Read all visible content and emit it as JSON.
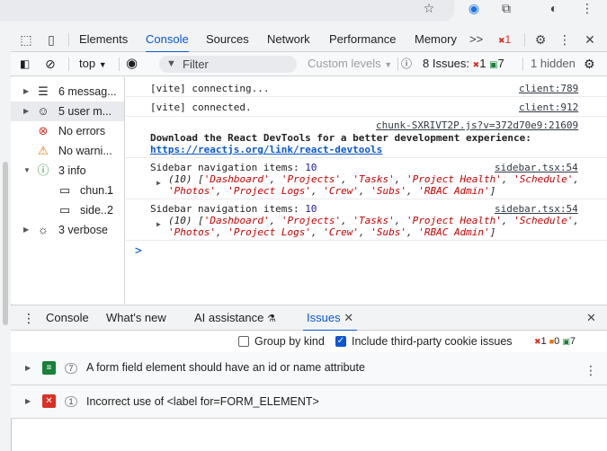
{
  "colors": {
    "accent": "#0b57d0",
    "error": "#d93025",
    "warning": "#e37400",
    "info": "#1e8e3e",
    "chat": "#188038"
  },
  "main_tabs": [
    "Elements",
    "Console",
    "Sources",
    "Network",
    "Performance",
    "Memory"
  ],
  "main_tabs_active": "Console",
  "tabbar": {
    "more": ">>",
    "error_count": "1"
  },
  "console_toolbar": {
    "context": "top",
    "filter_placeholder": "Filter",
    "levels": "Custom levels",
    "issues_label": "8 Issues:",
    "issues_errors": "1",
    "issues_messages": "7",
    "hidden": "1 hidden"
  },
  "sidebar": {
    "items": [
      {
        "label": "6 messag...",
        "icon": "list-icon",
        "count": ""
      },
      {
        "label": "5 user m...",
        "icon": "user-icon",
        "count": ""
      },
      {
        "label": "No errors",
        "icon": "error-icon",
        "count": ""
      },
      {
        "label": "No warni...",
        "icon": "warning-icon",
        "count": ""
      },
      {
        "label": "3 info",
        "icon": "info-icon",
        "count": ""
      },
      {
        "label": "chun...",
        "icon": "file-icon",
        "count": "1"
      },
      {
        "label": "side...",
        "icon": "file-icon",
        "count": "2"
      },
      {
        "label": "3 verbose",
        "icon": "bug-icon",
        "count": ""
      }
    ]
  },
  "log": {
    "m1": {
      "text": "[vite] connecting...",
      "src": "client:789"
    },
    "m2": {
      "text": "[vite] connected.",
      "src": "client:912"
    },
    "m3": {
      "src": "chunk-SXRIVT2P.js?v=372d70e9:21609",
      "text": "Download the React DevTools for a better development experience:",
      "link": "https://reactjs.org/link/react-devtools"
    },
    "m4": {
      "label": "Sidebar navigation items: ",
      "count": "10",
      "src": "sidebar.tsx:54",
      "array_head": "(10) [",
      "items_line1": [
        "'Dashboard'",
        "'Projects'",
        "'Tasks'",
        "'Project Health'",
        "'Schedule'"
      ],
      "items_line2": [
        "'Photos'",
        "'Project Logs'",
        "'Crew'",
        "'Subs'",
        "'RBAC Admin'"
      ]
    },
    "m5": {
      "label": "Sidebar navigation items: ",
      "count": "10",
      "src": "sidebar.tsx:54",
      "array_head": "(10) [",
      "items_line1": [
        "'Dashboard'",
        "'Projects'",
        "'Tasks'",
        "'Project Health'",
        "'Schedule'"
      ],
      "items_line2": [
        "'Photos'",
        "'Project Logs'",
        "'Crew'",
        "'Subs'",
        "'RBAC Admin'"
      ]
    },
    "prompt": ">"
  },
  "drawer": {
    "tabs": [
      "Console",
      "What's new",
      "AI assistance",
      "Issues"
    ],
    "active": "Issues"
  },
  "issues": {
    "group_by_kind": "Group by kind",
    "include_third_party": "Include third-party cookie issues",
    "count_errors": "1",
    "count_warnings": "0",
    "count_messages": "7",
    "rows": [
      {
        "count": "7",
        "text": "A form field element should have an id or name attribute",
        "kind": "chat-icon"
      },
      {
        "count": "1",
        "text": "Incorrect use of <label for=FORM_ELEMENT>",
        "kind": "error-icon"
      }
    ]
  }
}
